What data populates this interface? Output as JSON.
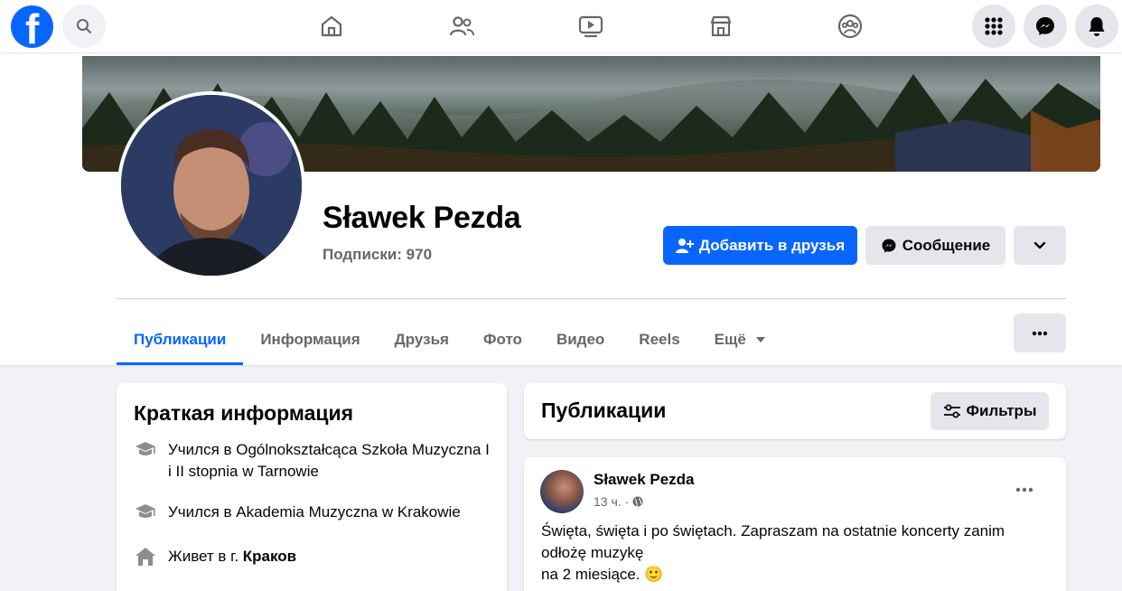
{
  "topbar": {
    "logo_letter": "f",
    "icons": [
      "search-icon",
      "home-icon",
      "friends-icon",
      "video-icon",
      "marketplace-icon",
      "groups-icon",
      "menu-grid-icon",
      "messenger-icon",
      "bell-icon"
    ]
  },
  "profile": {
    "name": "Sławek Pezda",
    "followers": "Подписки: 970",
    "add_friend_label": "Добавить в друзья",
    "message_label": "Сообщение"
  },
  "tabs": [
    {
      "label": "Публикации",
      "active": true
    },
    {
      "label": "Информация"
    },
    {
      "label": "Друзья"
    },
    {
      "label": "Фото"
    },
    {
      "label": "Видео"
    },
    {
      "label": "Reels"
    },
    {
      "label": "Ещё"
    }
  ],
  "intro": {
    "title": "Краткая информация",
    "items": [
      {
        "icon": "graduation-cap-icon",
        "text": "Учился в Ogólnokształcąca Szkoła Muzyczna I i II stopnia w Tarnowie"
      },
      {
        "icon": "graduation-cap-icon",
        "text": "Учился в Akademia Muzyczna w Krakowie"
      },
      {
        "icon": "home-icon",
        "text_prefix": "Живет в г. ",
        "text_bold": "Краков"
      }
    ]
  },
  "posts": {
    "title": "Публикации",
    "filter_label": "Фильтры",
    "post": {
      "author": "Sławek Pezda",
      "time": "13 ч. ·",
      "text_line1": "Święta, święta i po świętach. Zapraszam na ostatnie koncerty zanim",
      "text_line2": "odłożę muzykę",
      "text_line3": "na 2 miesiące. 🙂"
    }
  },
  "colors": {
    "accent": "#0866ff",
    "secondary_bg": "#e4e6eb",
    "page_bg": "#f0f2f5",
    "muted_text": "#65676b"
  }
}
